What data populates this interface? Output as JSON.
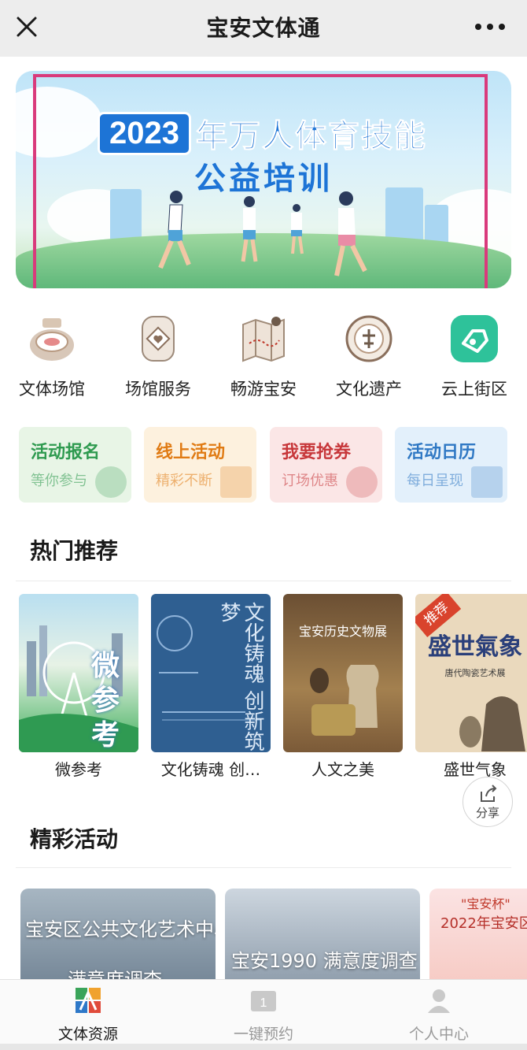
{
  "titlebar": {
    "title": "宝安文体通"
  },
  "banner": {
    "year": "2023",
    "line1": "年万人体育技能",
    "line2": "公益培训"
  },
  "quick_links": [
    {
      "label": "文体场馆",
      "icon": "venue-icon"
    },
    {
      "label": "场馆服务",
      "icon": "service-icon"
    },
    {
      "label": "畅游宝安",
      "icon": "map-icon"
    },
    {
      "label": "文化遗产",
      "icon": "heritage-icon"
    },
    {
      "label": "云上街区",
      "icon": "cloud-district-icon"
    }
  ],
  "activity_cards": [
    {
      "title": "活动报名",
      "subtitle": "等你参与",
      "color": "#2e9a4f",
      "bg": "#e8f5e6"
    },
    {
      "title": "线上活动",
      "subtitle": "精彩不断",
      "color": "#e07b14",
      "bg": "#fdf1de"
    },
    {
      "title": "我要抢券",
      "subtitle": "订场优惠",
      "color": "#c7373a",
      "bg": "#fbe6e6"
    },
    {
      "title": "活动日历",
      "subtitle": "每日呈现",
      "color": "#2f78c4",
      "bg": "#e3f0fb"
    }
  ],
  "sections": {
    "recommend": "热门推荐",
    "events": "精彩活动"
  },
  "posters": [
    {
      "caption": "微参考",
      "text": "微参考"
    },
    {
      "caption": "文化铸魂 创…",
      "text": "文化铸魂 创新筑梦"
    },
    {
      "caption": "人文之美",
      "text": "宝安历史文物展"
    },
    {
      "caption": "盛世气象",
      "text": "盛世氣象",
      "sub": "唐代陶瓷艺术展",
      "badge": "推荐"
    }
  ],
  "share": {
    "label": "分享"
  },
  "events": [
    {
      "title": "宝安区公共文化艺术中心",
      "sub": "满意度调查"
    },
    {
      "title": "宝安1990 满意度调查"
    },
    {
      "title": "2022年宝安区",
      "sub": "\"宝安杯\""
    }
  ],
  "tabs": [
    {
      "label": "文体资源",
      "active": true
    },
    {
      "label": "一键预约",
      "active": false
    },
    {
      "label": "个人中心",
      "active": false
    }
  ]
}
